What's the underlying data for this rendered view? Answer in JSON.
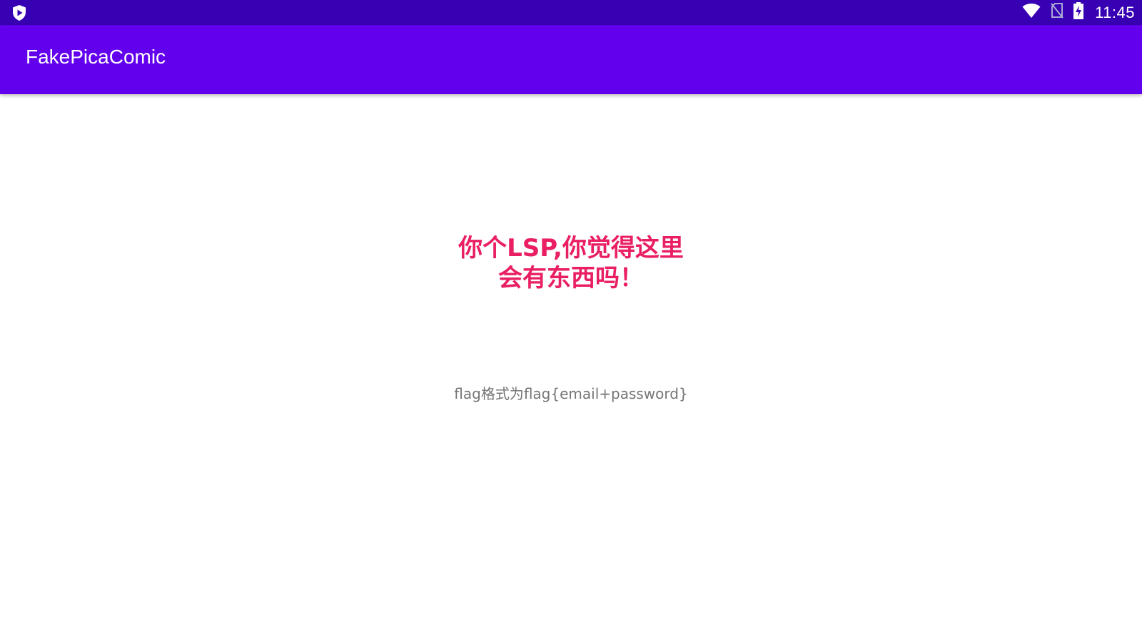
{
  "status_bar": {
    "time": "11:45",
    "icons": [
      "shield-play-icon",
      "wifi-icon",
      "no-sim-icon",
      "battery-charging-icon"
    ],
    "background": "#3700b3"
  },
  "app_bar": {
    "title": "FakePicaComic",
    "background": "#6200ee"
  },
  "main": {
    "headline": "你个LSP,你觉得这里会有东西吗！",
    "headline_color": "#e91e63",
    "flag_hint": "flag格式为flag{email+password}",
    "flag_hint_color": "#757575"
  }
}
